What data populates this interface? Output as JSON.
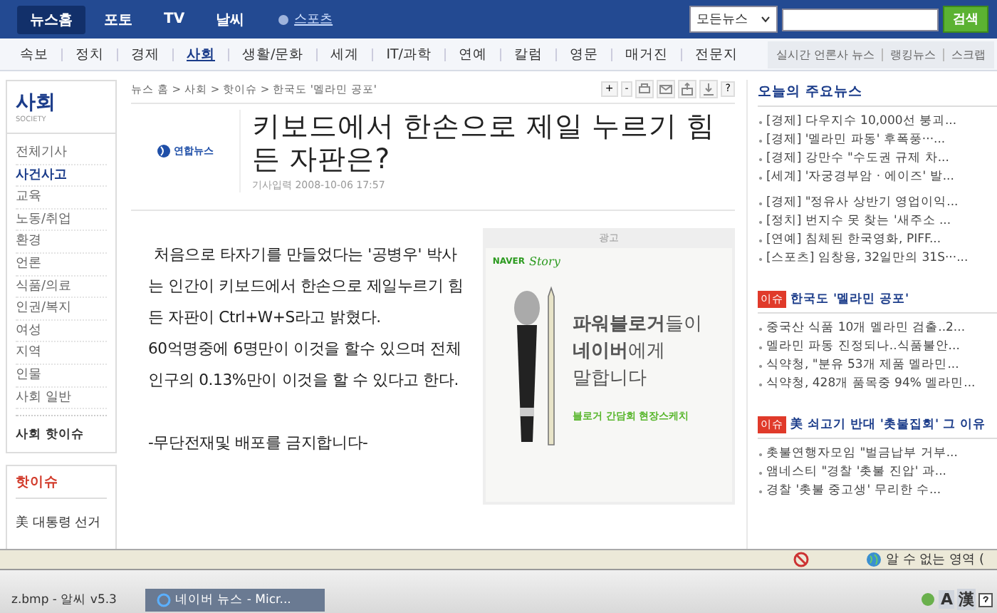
{
  "top_tabs": [
    {
      "label": "뉴스홈",
      "selected": true
    },
    {
      "label": "포토",
      "selected": false
    },
    {
      "label": "TV",
      "selected": false
    },
    {
      "label": "날씨",
      "selected": false
    }
  ],
  "sports_link": "스포츠",
  "search": {
    "scope": "모든뉴스",
    "button": "검색"
  },
  "nav": [
    {
      "label": "속보",
      "selected": false
    },
    {
      "label": "정치",
      "selected": false
    },
    {
      "label": "경제",
      "selected": false
    },
    {
      "label": "사회",
      "selected": true
    },
    {
      "label": "생활/문화",
      "selected": false
    },
    {
      "label": "세계",
      "selected": false
    },
    {
      "label": "IT/과학",
      "selected": false
    },
    {
      "label": "연예",
      "selected": false
    },
    {
      "label": "칼럼",
      "selected": false
    },
    {
      "label": "영문",
      "selected": false
    },
    {
      "label": "매거진",
      "selected": false
    },
    {
      "label": "전문지",
      "selected": false
    }
  ],
  "nav_right": [
    "실시간 언론사 뉴스",
    "랭킹뉴스",
    "스크랩"
  ],
  "sidebar": {
    "title": "사회",
    "subtitle": "SOCIETY",
    "items": [
      {
        "label": "전체기사",
        "selected": false
      },
      {
        "label": "사건사고",
        "selected": true
      },
      {
        "label": "교육",
        "selected": false
      },
      {
        "label": "노동/취업",
        "selected": false
      },
      {
        "label": "환경",
        "selected": false
      },
      {
        "label": "언론",
        "selected": false
      },
      {
        "label": "식품/의료",
        "selected": false
      },
      {
        "label": "인권/복지",
        "selected": false
      },
      {
        "label": "여성",
        "selected": false
      },
      {
        "label": "지역",
        "selected": false
      },
      {
        "label": "인물",
        "selected": false
      },
      {
        "label": "사회 일반",
        "selected": false
      }
    ],
    "hot_link": "사회 핫이슈",
    "hot_title": "핫이슈",
    "hot_items": [
      "美 대통령 선거"
    ]
  },
  "article": {
    "breadcrumb": "뉴스 홈 > 사회 > 핫이슈 > 한국도 '멜라민 공포'",
    "tools": [
      "+",
      "-",
      "?"
    ],
    "source": "연합뉴스",
    "title": "키보드에서 한손으로 제일 누르기 힘든 자판은?",
    "date": "기사입력 2008-10-06 17:57",
    "body": [
      "처음으로 타자기를 만들었다는 '공병우' 박사는 인간이 키보드에서 한손으로 제일누르기 힘든 자판이 Ctrl+W+S라고 밝혔다.",
      "60억명중에 6명만이 이것을 할수 있으며 전체 인구의 0.13%만이 이것을 할 수 있다고 한다.",
      "-무단전재및 배포를 금지합니다-"
    ],
    "ad": {
      "label": "광고",
      "brand": "NAVER",
      "brand_script": "Story",
      "lines": [
        "**파워블로거**들이",
        "**네이버**에게",
        "말합니다"
      ],
      "caption": "블로거 간담회 현장스케치"
    }
  },
  "right": {
    "title": "오늘의 주요뉴스",
    "groups": [
      [
        "[경제] 다우지수 10,000선 붕괴...",
        "[경제] '멜라민 파동' 후폭풍···...",
        "[경제] 강만수 \"수도권 규제 차...",
        "[세계] '자궁경부암 · 에이즈' 발..."
      ],
      [
        "[경제] \"정유사 상반기 영업이익...",
        "[정치] 번지수 못 찾는 '새주소 ...",
        "[연예] 침체된 한국영화, PIFF...",
        "[스포츠] 임창용, 32일만의 31S···..."
      ]
    ],
    "issues": [
      {
        "badge": "이슈",
        "title": "한국도 '멜라민 공포'",
        "items": [
          "중국산 식품 10개 멜라민 검출..2...",
          "멜라민 파동 진정되나..식품불안...",
          "식약청, \"분유 53개 제품 멜라민...",
          "식약청, 428개 품목중 94% 멜라민..."
        ]
      },
      {
        "badge": "이슈",
        "title": "美 쇠고기 반대 '촛불집회' 그 이유",
        "items": [
          "촛불연행자모임 \"벌금납부 거부...",
          "앰네스티 \"경찰 '촛불 진압' 과...",
          "경찰 '촛불 중고생' 무리한 수..."
        ]
      }
    ]
  },
  "status_bar": {
    "zone": "알 수 없는 영역 ("
  },
  "taskbar": {
    "tasks": [
      {
        "label": "z.bmp - 알씨 v5.3",
        "selected": false
      },
      {
        "label": "네이버 뉴스 - Micr...",
        "selected": true
      }
    ],
    "tray": [
      "A",
      "漢"
    ]
  }
}
